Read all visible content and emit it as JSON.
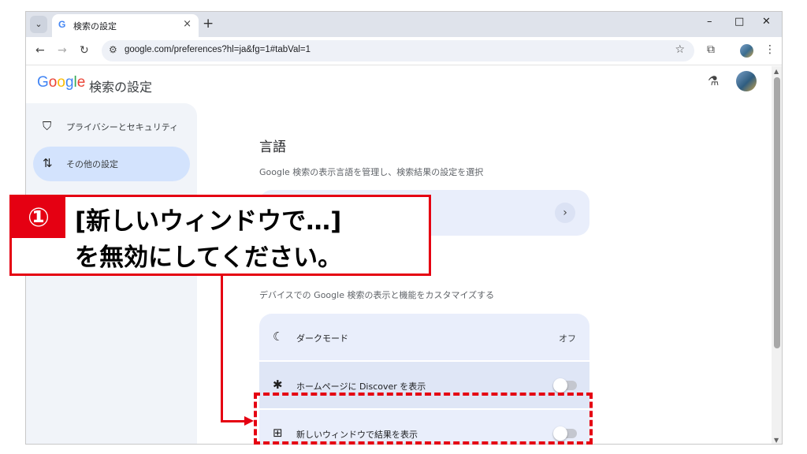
{
  "colors": {
    "accent_red": "#e50012",
    "sidebar_active": "#d3e3fd",
    "card_bg": "#e9eefb"
  },
  "tab": {
    "favicon": "G",
    "title": "検索の設定",
    "close": "×",
    "new_tab": "+"
  },
  "window_controls": {
    "minimize": "–",
    "maximize": "□",
    "close": "✕"
  },
  "toolbar": {
    "back": "←",
    "forward": "→",
    "reload": "↻",
    "url": "google.com/preferences?hl=ja&fg=1#tabVal=1",
    "star": "☆",
    "extensions": "⧉",
    "menu": "⋮"
  },
  "page": {
    "logo": [
      "G",
      "o",
      "o",
      "g",
      "l",
      "e"
    ],
    "title": "検索の設定",
    "labs_icon": "flask-icon"
  },
  "sidebar": {
    "items": [
      {
        "icon": "shield-icon",
        "glyph": "⛉",
        "label": "プライバシーとセキュリティ",
        "active": false
      },
      {
        "icon": "tune-icon",
        "glyph": "⇅",
        "label": "その他の設定",
        "active": true
      }
    ]
  },
  "sections": {
    "language": {
      "title": "言語",
      "description": "Google 検索の表示言語を管理し、検索結果の設定を選択"
    },
    "display": {
      "description": "デバイスでの Google 検索の表示と機能をカスタマイズする",
      "rows": [
        {
          "icon": "moon-icon",
          "glyph": "☾",
          "label": "ダークモード",
          "value": "オフ"
        },
        {
          "icon": "discover-icon",
          "glyph": "✱",
          "label": "ホームページに Discover を表示",
          "toggle": "off"
        },
        {
          "icon": "new-window-icon",
          "glyph": "⊞",
          "label": "新しいウィンドウで結果を表示",
          "toggle": "off"
        }
      ]
    }
  },
  "callout": {
    "number": "①",
    "line1": "[新しいウィンドウで…]",
    "line2": "を無効にしてください。"
  }
}
